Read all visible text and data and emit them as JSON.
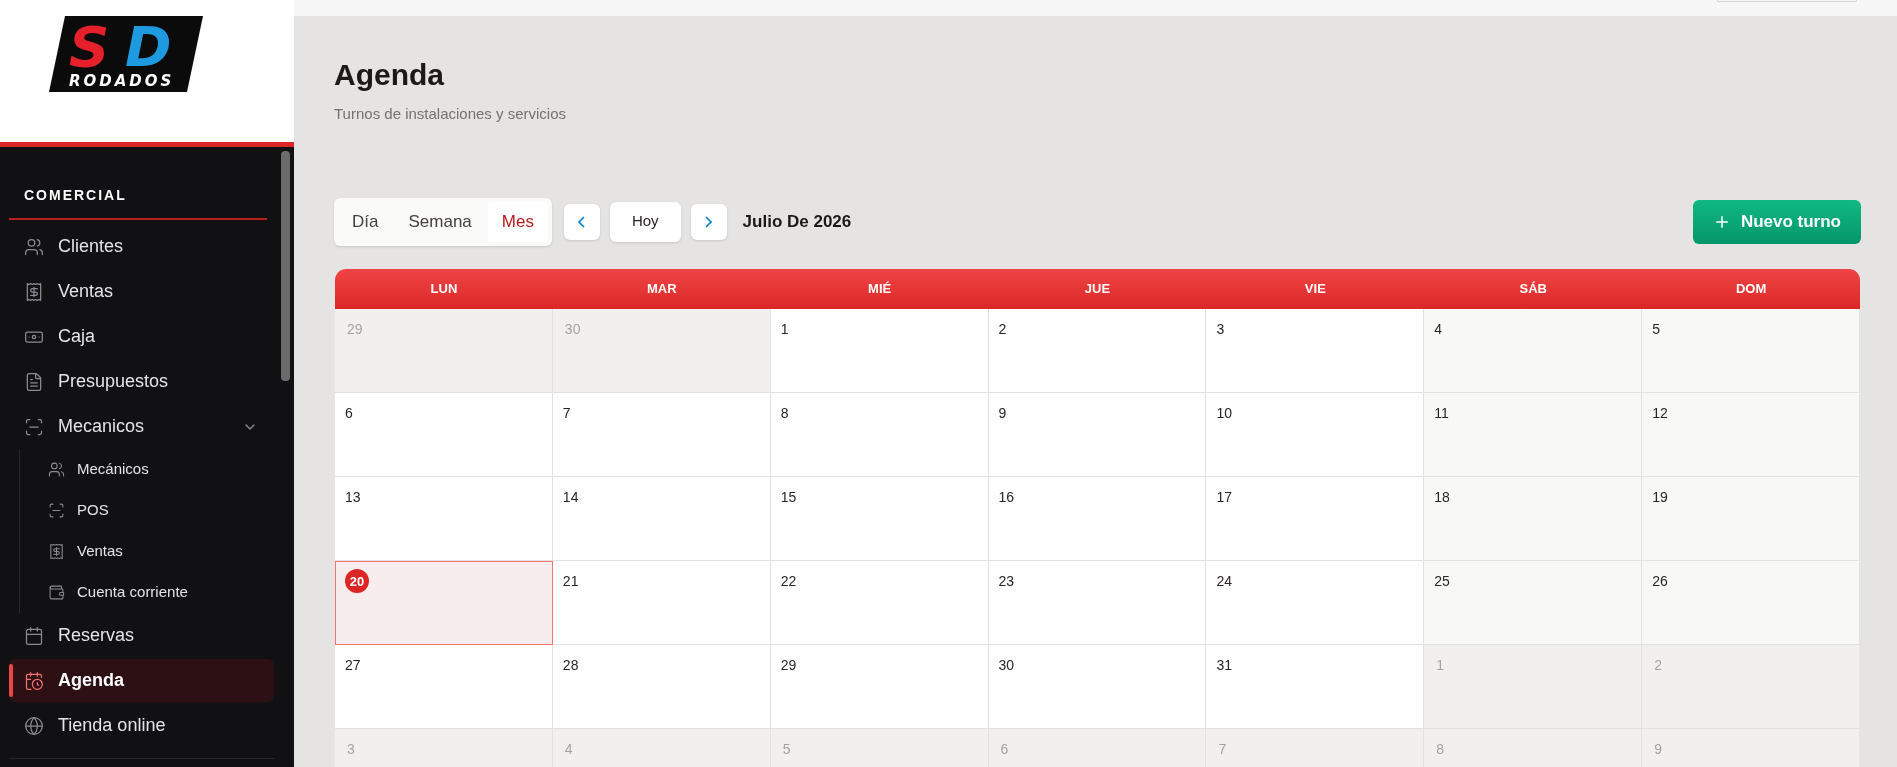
{
  "logo": {
    "letter_1": "S",
    "letter_2": "D",
    "tagline": "RODADOS"
  },
  "sidebar": {
    "section": "COMERCIAL",
    "items": [
      {
        "label": "Clientes",
        "selected": false
      },
      {
        "label": "Ventas",
        "selected": false
      },
      {
        "label": "Caja",
        "selected": false
      },
      {
        "label": "Presupuestos",
        "selected": false
      },
      {
        "label": "Mecanicos",
        "selected": false,
        "expanded": true,
        "children": [
          {
            "label": "Mecánicos"
          },
          {
            "label": "POS"
          },
          {
            "label": "Ventas"
          },
          {
            "label": "Cuenta corriente"
          }
        ]
      },
      {
        "label": "Reservas",
        "selected": false
      },
      {
        "label": "Agenda",
        "selected": true
      },
      {
        "label": "Tienda online",
        "selected": false
      }
    ]
  },
  "page": {
    "title": "Agenda",
    "subtitle": "Turnos de instalaciones y servicios"
  },
  "toolbar": {
    "views": [
      {
        "label": "Día",
        "selected": false
      },
      {
        "label": "Semana",
        "selected": false
      },
      {
        "label": "Mes",
        "selected": true
      }
    ],
    "today_button": "Hoy",
    "period": "Julio De 2026",
    "new_button": "Nuevo turno"
  },
  "calendar": {
    "weekdays": [
      "LUN",
      "MAR",
      "MIÉ",
      "JUE",
      "VIE",
      "SÁB",
      "DOM"
    ],
    "weeks": [
      [
        {
          "label": "29",
          "kind": "outside",
          "today": false
        },
        {
          "label": "30",
          "kind": "outside",
          "today": false
        },
        {
          "label": "1",
          "kind": "current",
          "today": false
        },
        {
          "label": "2",
          "kind": "current",
          "today": false
        },
        {
          "label": "3",
          "kind": "current",
          "today": false
        },
        {
          "label": "4",
          "kind": "current",
          "today": false
        },
        {
          "label": "5",
          "kind": "current",
          "today": false
        }
      ],
      [
        {
          "label": "6",
          "kind": "current",
          "today": false
        },
        {
          "label": "7",
          "kind": "current",
          "today": false
        },
        {
          "label": "8",
          "kind": "current",
          "today": false
        },
        {
          "label": "9",
          "kind": "current",
          "today": false
        },
        {
          "label": "10",
          "kind": "current",
          "today": false
        },
        {
          "label": "11",
          "kind": "current",
          "today": false
        },
        {
          "label": "12",
          "kind": "current",
          "today": false
        }
      ],
      [
        {
          "label": "13",
          "kind": "current",
          "today": false
        },
        {
          "label": "14",
          "kind": "current",
          "today": false
        },
        {
          "label": "15",
          "kind": "current",
          "today": false
        },
        {
          "label": "16",
          "kind": "current",
          "today": false
        },
        {
          "label": "17",
          "kind": "current",
          "today": false
        },
        {
          "label": "18",
          "kind": "current",
          "today": false
        },
        {
          "label": "19",
          "kind": "current",
          "today": false
        }
      ],
      [
        {
          "label": "20",
          "kind": "current",
          "today": true
        },
        {
          "label": "21",
          "kind": "current",
          "today": false
        },
        {
          "label": "22",
          "kind": "current",
          "today": false
        },
        {
          "label": "23",
          "kind": "current",
          "today": false
        },
        {
          "label": "24",
          "kind": "current",
          "today": false
        },
        {
          "label": "25",
          "kind": "current",
          "today": false
        },
        {
          "label": "26",
          "kind": "current",
          "today": false
        }
      ],
      [
        {
          "label": "27",
          "kind": "current",
          "today": false
        },
        {
          "label": "28",
          "kind": "current",
          "today": false
        },
        {
          "label": "29",
          "kind": "current",
          "today": false
        },
        {
          "label": "30",
          "kind": "current",
          "today": false
        },
        {
          "label": "31",
          "kind": "current",
          "today": false
        },
        {
          "label": "1",
          "kind": "outside",
          "today": false
        },
        {
          "label": "2",
          "kind": "outside",
          "today": false
        }
      ],
      [
        {
          "label": "3",
          "kind": "outside",
          "today": false
        },
        {
          "label": "4",
          "kind": "outside",
          "today": false
        },
        {
          "label": "5",
          "kind": "outside",
          "today": false
        },
        {
          "label": "6",
          "kind": "outside",
          "today": false
        },
        {
          "label": "7",
          "kind": "outside",
          "today": false
        },
        {
          "label": "8",
          "kind": "outside",
          "today": false
        },
        {
          "label": "9",
          "kind": "outside",
          "today": false
        }
      ]
    ]
  }
}
